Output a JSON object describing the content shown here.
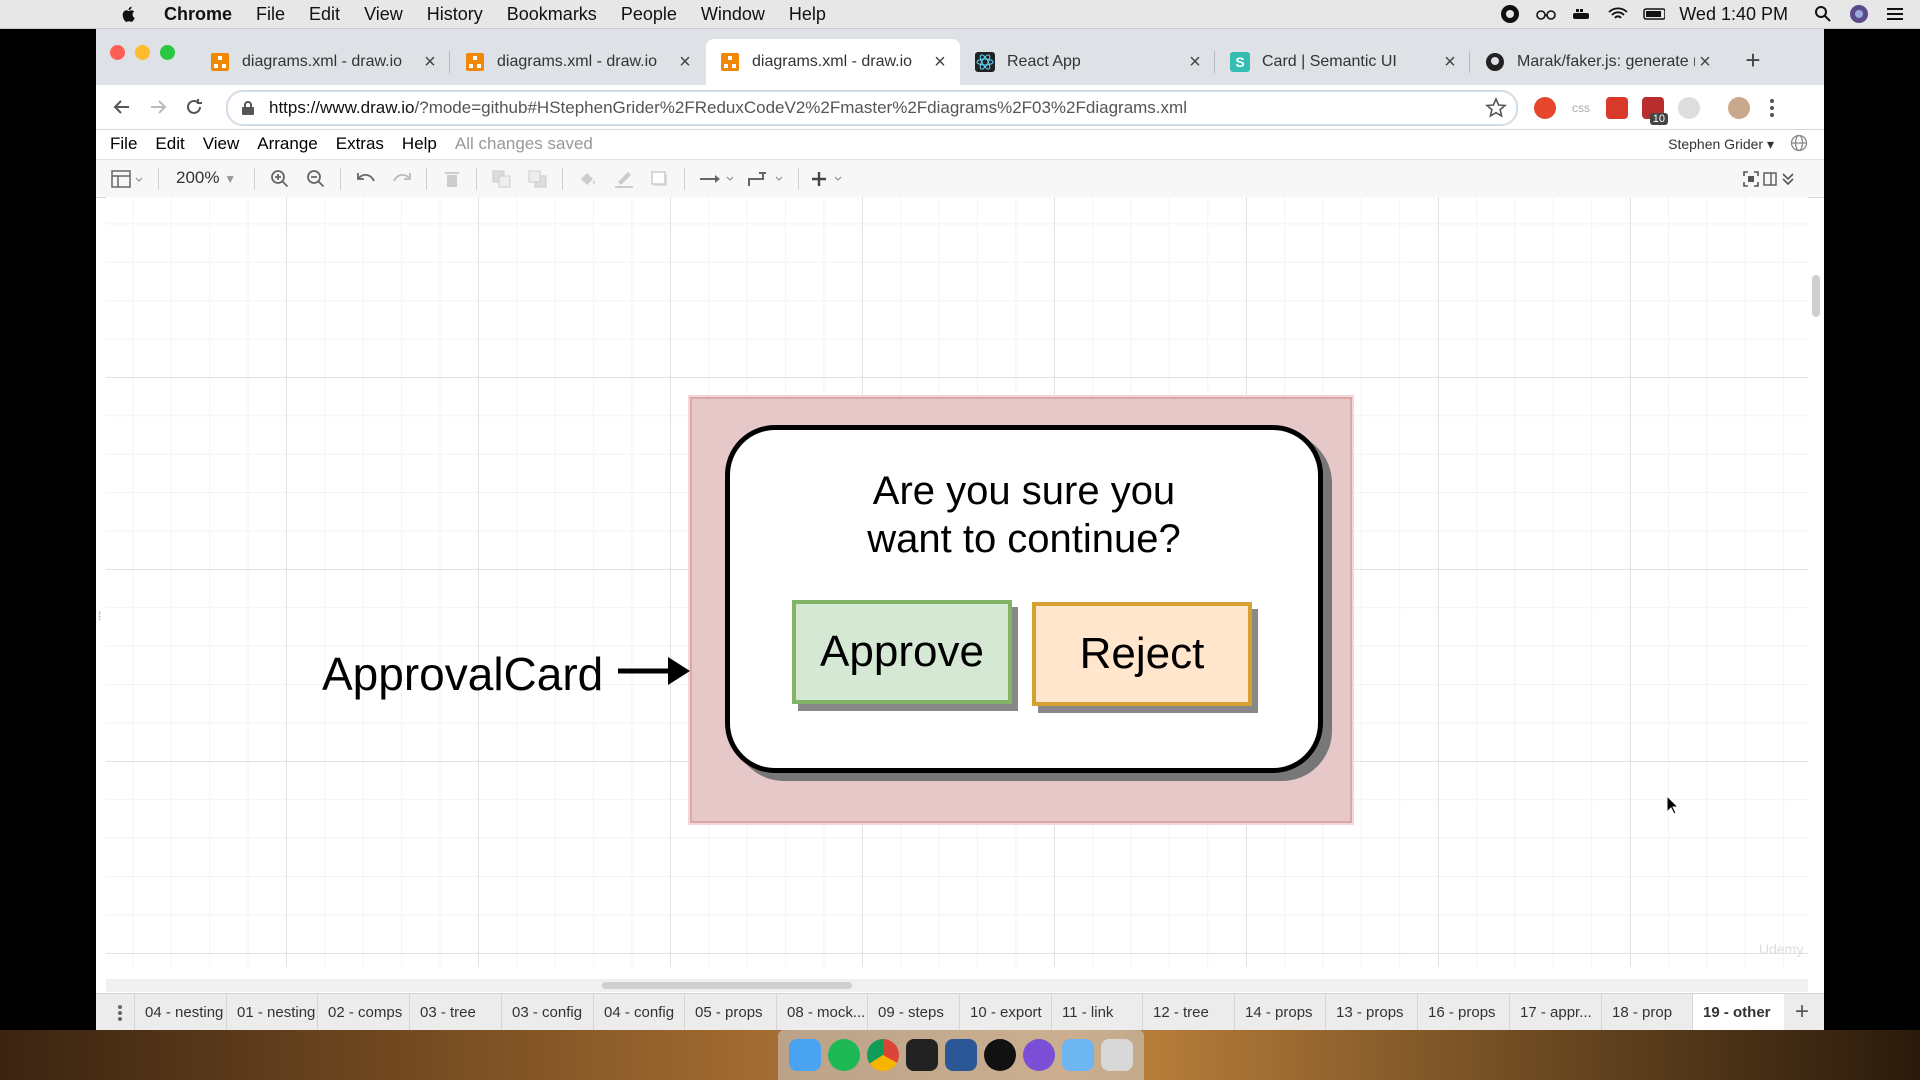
{
  "mac_menubar": {
    "app": "Chrome",
    "items": [
      "File",
      "Edit",
      "View",
      "History",
      "Bookmarks",
      "People",
      "Window",
      "Help"
    ],
    "clock": "Wed 1:40 PM"
  },
  "tabs": [
    {
      "title": "diagrams.xml - draw.io",
      "icon": "drawio-icon",
      "active": false
    },
    {
      "title": "diagrams.xml - draw.io",
      "icon": "drawio-icon",
      "active": false
    },
    {
      "title": "diagrams.xml - draw.io",
      "icon": "drawio-icon",
      "active": true
    },
    {
      "title": "React App",
      "icon": "react-icon",
      "active": false
    },
    {
      "title": "Card | Semantic UI",
      "icon": "semantic-ui-icon",
      "active": false
    },
    {
      "title": "Marak/faker.js: generate m",
      "icon": "github-icon",
      "active": false
    }
  ],
  "address": {
    "host": "https://www.draw.io",
    "path": "/?mode=github#HStephenGrider%2FReduxCodeV2%2Fmaster%2Fdiagrams%2F03%2Fdiagrams.xml"
  },
  "extension_badge": "10",
  "drawio_menu": {
    "items": [
      "File",
      "Edit",
      "View",
      "Arrange",
      "Extras",
      "Help"
    ],
    "status": "All changes saved",
    "user": "Stephen Grider"
  },
  "drawio_toolbar": {
    "zoom": "200%"
  },
  "diagram": {
    "question_line1": "Are you sure you",
    "question_line2": "want to continue?",
    "approve_label": "Approve",
    "reject_label": "Reject",
    "card_label": "ApprovalCard",
    "container_color": "#e6c8c8",
    "approve_fill": "#d5e8d4",
    "approve_stroke": "#82b366",
    "reject_fill": "#ffe6cc",
    "reject_stroke": "#d6a033"
  },
  "watermark": "Udemy",
  "page_tabs": [
    "04 - nesting",
    "01 - nesting",
    "02 - comps",
    "03 - tree",
    "03 - config",
    "04 - config",
    "05 - props",
    "08 - mock...",
    "09 - steps",
    "10 - export",
    "11 - link",
    "12 - tree",
    "14 - props",
    "13 - props",
    "16 - props",
    "17 - appr...",
    "18 - prop",
    "19 - other"
  ],
  "active_page_tab": "19 - other"
}
